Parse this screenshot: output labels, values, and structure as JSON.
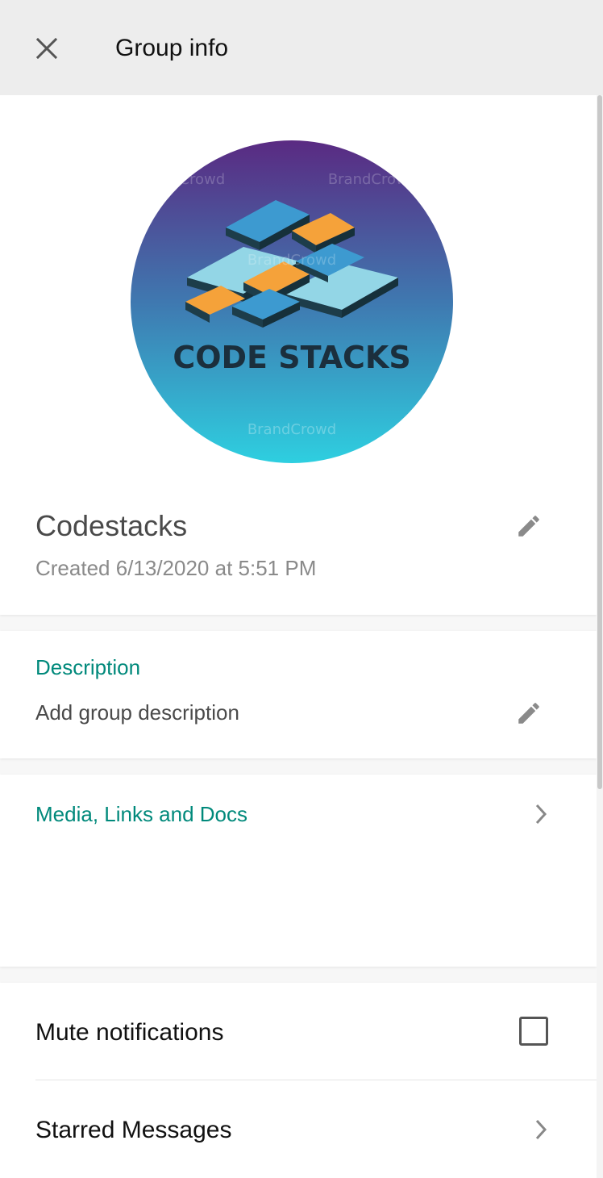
{
  "header": {
    "title": "Group info",
    "close_icon": "close-icon"
  },
  "profile": {
    "avatar_text": "CODE STACKS",
    "avatar_watermark": "BrandCrowd",
    "group_name": "Codestacks",
    "created": "Created 6/13/2020 at 5:51 PM"
  },
  "description": {
    "label": "Description",
    "placeholder": "Add group description"
  },
  "media": {
    "label": "Media, Links and Docs"
  },
  "settings": {
    "mute_label": "Mute notifications",
    "mute_checked": false,
    "starred_label": "Starred Messages"
  },
  "colors": {
    "accent": "#00897b",
    "header_bg": "#ededed",
    "avatar_gradient_top": "#5a2a82",
    "avatar_gradient_bottom": "#2ecfe0"
  }
}
